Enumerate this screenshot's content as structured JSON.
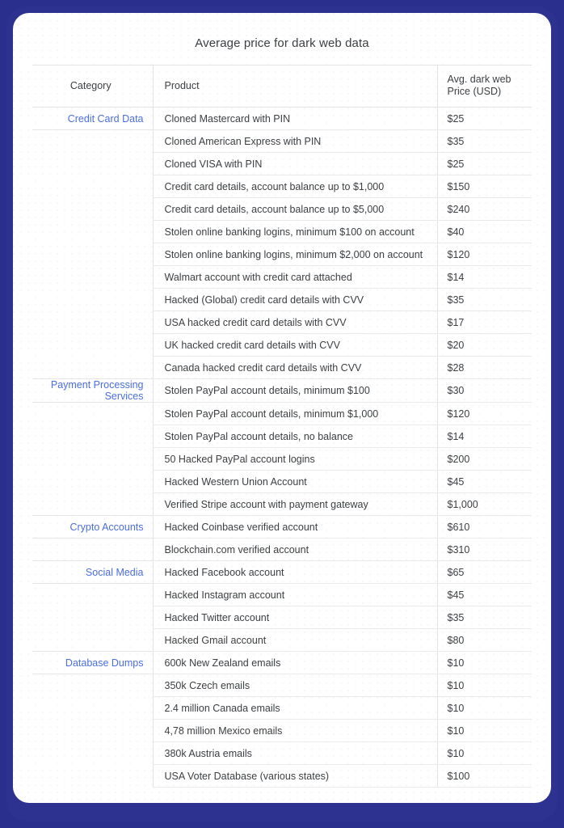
{
  "theme": {
    "background_color": "#2a2e8c",
    "card_color": "#ffffff",
    "category_link_color": "#4a6ee0",
    "text_color": "#3c4043",
    "rule_color": "#e3e3e3"
  },
  "title": "Average price for dark web data",
  "table": {
    "columns": [
      {
        "key": "category",
        "label": "Category"
      },
      {
        "key": "product",
        "label": "Product"
      },
      {
        "key": "price",
        "label": "Avg. dark web Price (USD)",
        "label_line1": "Avg. dark web",
        "label_line2": "Price (USD)"
      }
    ],
    "rows": [
      {
        "category": "Credit Card Data",
        "product": "Cloned Mastercard with PIN",
        "price": "$25"
      },
      {
        "category": "",
        "product": "Cloned American Express with PIN",
        "price": "$35"
      },
      {
        "category": "",
        "product": "Cloned VISA with PIN",
        "price": "$25"
      },
      {
        "category": "",
        "product": "Credit card details, account balance up to $1,000",
        "price": "$150"
      },
      {
        "category": "",
        "product": "Credit card details, account balance up to $5,000",
        "price": "$240"
      },
      {
        "category": "",
        "product": "Stolen online banking logins, minimum $100 on account",
        "price": "$40"
      },
      {
        "category": "",
        "product": "Stolen online banking logins, minimum $2,000 on account",
        "price": "$120"
      },
      {
        "category": "",
        "product": "Walmart account with credit card attached",
        "price": "$14"
      },
      {
        "category": "",
        "product": "Hacked (Global) credit card details with CVV",
        "price": "$35"
      },
      {
        "category": "",
        "product": "USA hacked credit card details with CVV",
        "price": "$17"
      },
      {
        "category": "",
        "product": "UK hacked credit card details with CVV",
        "price": "$20"
      },
      {
        "category": "",
        "product": "Canada hacked credit card details with CVV",
        "price": "$28"
      },
      {
        "category": "Payment Processing Services",
        "product": "Stolen PayPal account details, minimum $100",
        "price": "$30"
      },
      {
        "category": "",
        "product": "Stolen PayPal account details, minimum $1,000",
        "price": "$120"
      },
      {
        "category": "",
        "product": "Stolen PayPal account details, no balance",
        "price": "$14"
      },
      {
        "category": "",
        "product": "50 Hacked PayPal account logins",
        "price": "$200"
      },
      {
        "category": "",
        "product": "Hacked Western Union Account",
        "price": "$45"
      },
      {
        "category": "",
        "product": "Verified Stripe account with payment gateway",
        "price": "$1,000"
      },
      {
        "category": "Crypto Accounts",
        "product": "Hacked Coinbase verified account",
        "price": "$610"
      },
      {
        "category": "",
        "product": "Blockchain.com verified account",
        "price": "$310"
      },
      {
        "category": "Social Media",
        "product": "Hacked Facebook account",
        "price": "$65"
      },
      {
        "category": "",
        "product": "Hacked Instagram account",
        "price": "$45"
      },
      {
        "category": "",
        "product": "Hacked Twitter account",
        "price": "$35"
      },
      {
        "category": "",
        "product": "Hacked Gmail account",
        "price": "$80"
      },
      {
        "category": "Database Dumps",
        "product": "600k New Zealand emails",
        "price": "$10"
      },
      {
        "category": "",
        "product": "350k Czech emails",
        "price": "$10"
      },
      {
        "category": "",
        "product": "2.4 million Canada emails",
        "price": "$10"
      },
      {
        "category": "",
        "product": "4,78 million Mexico emails",
        "price": "$10"
      },
      {
        "category": "",
        "product": "380k Austria emails",
        "price": "$10"
      },
      {
        "category": "",
        "product": "USA Voter Database (various states)",
        "price": "$100"
      }
    ]
  }
}
